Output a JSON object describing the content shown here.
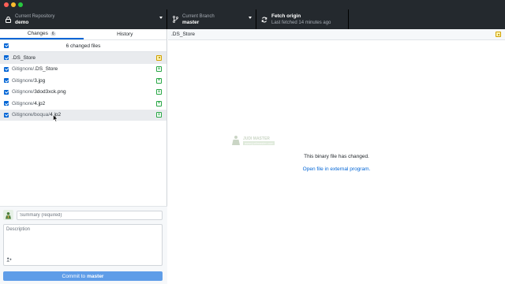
{
  "toolbar": {
    "repository": {
      "label": "Current Repository",
      "value": "demo"
    },
    "branch": {
      "label": "Current Branch",
      "value": "master"
    },
    "fetch": {
      "label": "Fetch origin",
      "sub": "Last fetched 14 minutes ago"
    }
  },
  "tabs": [
    {
      "label": "Changes",
      "count": "6"
    },
    {
      "label": "History"
    }
  ],
  "changes": {
    "summary": "6 changed files",
    "files": [
      {
        "dir": "",
        "name": ".DS_Store",
        "status": "modified"
      },
      {
        "dir": "Gitignore/",
        "name": ".DS_Store",
        "status": "added"
      },
      {
        "dir": "Gitignore/",
        "name": "3.jpg",
        "status": "added"
      },
      {
        "dir": "Gitignore/",
        "name": "3dod3xck.png",
        "status": "added"
      },
      {
        "dir": "Gitignore/",
        "name": "4.jp2",
        "status": "added"
      },
      {
        "dir": "Gitignore/boqua/",
        "name": "4.jp2",
        "status": "added"
      }
    ]
  },
  "commit": {
    "summary_placeholder": "Summary (required)",
    "description_placeholder": "Description",
    "button_prefix": "Commit to",
    "button_branch": "master"
  },
  "diff": {
    "filename": ".DS_Store",
    "message": "This binary file has changed.",
    "link": "Open file in external program.",
    "watermark_top": "JUDI MASTER",
    "watermark_bottom": "www.judimaster.com"
  },
  "colors": {
    "toolbar_bg": "#24292e",
    "accent": "#0366d6",
    "commit_button": "#5f9de8",
    "added": "#28a745",
    "modified": "#d1a100"
  },
  "icons": {
    "repo": "lock-icon",
    "branch": "git-branch-icon",
    "fetch": "sync-icon",
    "coauthor": "add-coauthor-icon"
  }
}
